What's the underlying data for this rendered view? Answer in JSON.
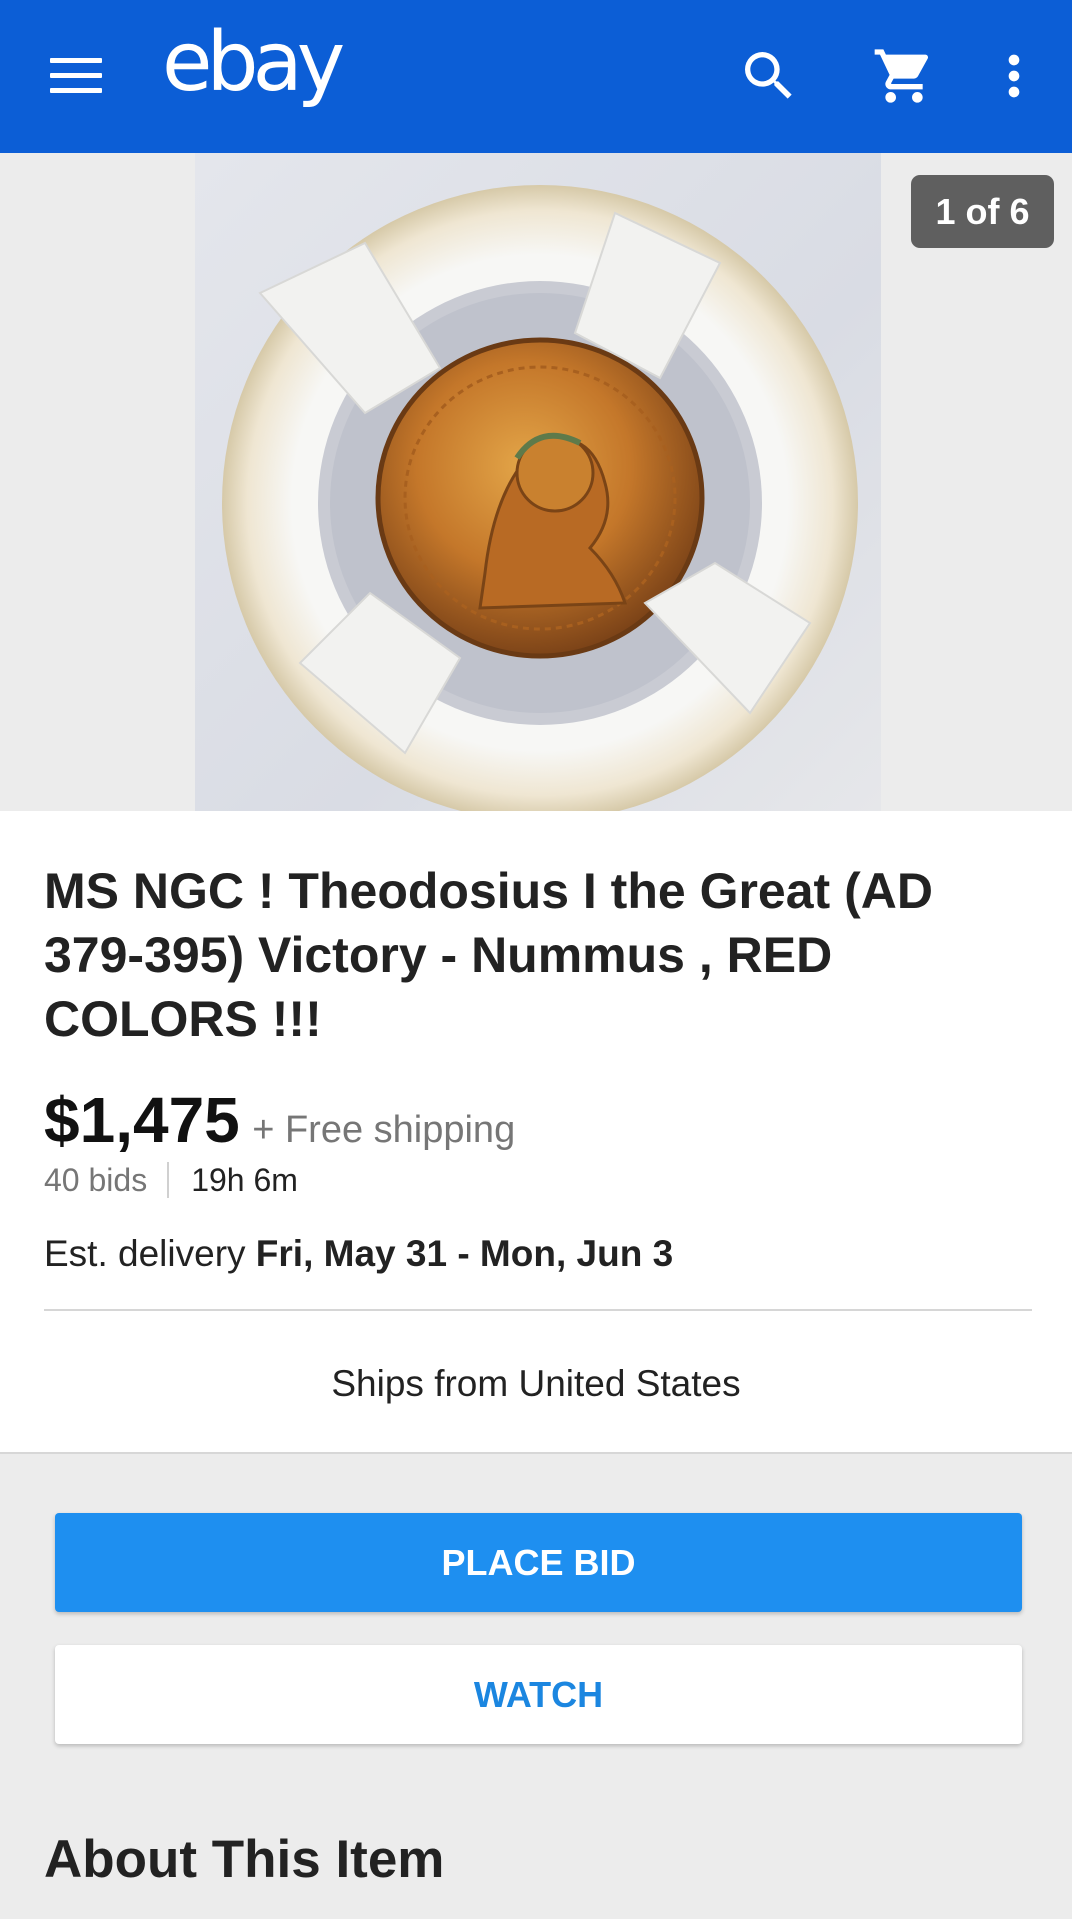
{
  "header": {
    "logo": "ebay",
    "icons": [
      "menu-icon",
      "search-icon",
      "cart-icon",
      "more-vert-icon"
    ],
    "color": "#0c5ed6"
  },
  "gallery": {
    "counter": "1 of 6",
    "image": "coin-photo"
  },
  "item": {
    "title": "MS NGC !  Theodosius I the Great (AD 379-395) Victory - Nummus , RED COLORS !!!",
    "price": "$1,475",
    "shipping": "+ Free shipping",
    "bids": "40 bids",
    "time_left": "19h 6m",
    "delivery_label": "Est. delivery",
    "delivery_dates": "Fri, May 31 - Mon, Jun 3",
    "ships_from": "Ships from United States"
  },
  "actions": {
    "place_bid": "PLACE BID",
    "watch": "WATCH",
    "primary_color": "#1e8ff0"
  },
  "section": {
    "about": "About This Item"
  }
}
